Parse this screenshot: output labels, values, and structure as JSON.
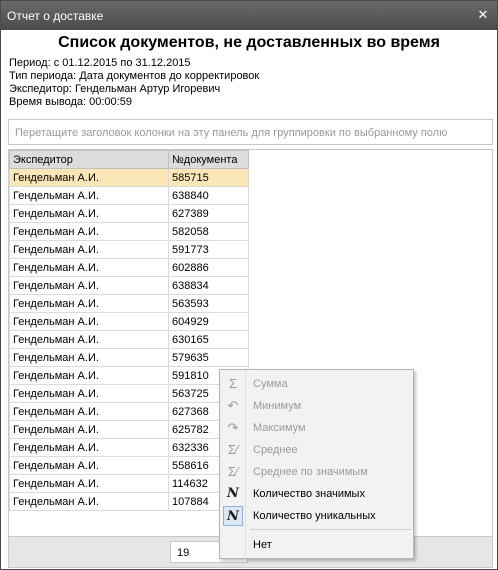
{
  "window": {
    "title": "Отчет о доставке",
    "close_glyph": "✕"
  },
  "report": {
    "title": "Список документов, не доставленных во время",
    "period": "Период: с 01.12.2015 по 31.12.2015",
    "period_type": "Тип периода: Дата документов до корректировок",
    "expeditor": "Экспедитор: Гендельман Артур Игоревич",
    "output_time": "Время вывода: 00:00:59"
  },
  "group_panel": {
    "hint": "Перетащите заголовок колонки на эту панель для группировки по выбранному полю"
  },
  "grid": {
    "columns": [
      "Экспедитор",
      "№документа"
    ],
    "rows": [
      [
        "Гендельман А.И.",
        "585715"
      ],
      [
        "Гендельман А.И.",
        "638840"
      ],
      [
        "Гендельман А.И.",
        "627389"
      ],
      [
        "Гендельман А.И.",
        "582058"
      ],
      [
        "Гендельман А.И.",
        "591773"
      ],
      [
        "Гендельман А.И.",
        "602886"
      ],
      [
        "Гендельман А.И.",
        "638834"
      ],
      [
        "Гендельман А.И.",
        "563593"
      ],
      [
        "Гендельман А.И.",
        "604929"
      ],
      [
        "Гендельман А.И.",
        "630165"
      ],
      [
        "Гендельман А.И.",
        "579635"
      ],
      [
        "Гендельман А.И.",
        "591810"
      ],
      [
        "Гендельман А.И.",
        "563725"
      ],
      [
        "Гендельман А.И.",
        "627368"
      ],
      [
        "Гендельман А.И.",
        "625782"
      ],
      [
        "Гендельман А.И.",
        "632336"
      ],
      [
        "Гендельман А.И.",
        "558616"
      ],
      [
        "Гендельман А.И.",
        "114632"
      ],
      [
        "Гендельман А.И.",
        "107884"
      ]
    ],
    "selected_row": 0,
    "summary_value": "19"
  },
  "context_menu": {
    "items": [
      {
        "label": "Сумма",
        "icon": "sum-icon",
        "glyph": "Σ",
        "enabled": false,
        "checked": false
      },
      {
        "label": "Минимум",
        "icon": "minimum-icon",
        "glyph": "↶",
        "enabled": false,
        "checked": false
      },
      {
        "label": "Максимум",
        "icon": "maximum-icon",
        "glyph": "↷",
        "enabled": false,
        "checked": false
      },
      {
        "label": "Среднее",
        "icon": "average-icon",
        "glyph": "Σ⁄",
        "enabled": false,
        "checked": false
      },
      {
        "label": "Среднее по значимым",
        "icon": "average-nonempty-icon",
        "glyph": "Σ⁄",
        "enabled": false,
        "checked": false
      },
      {
        "label": "Количество значимых",
        "icon": "count-nonempty-icon",
        "glyph": "N",
        "enabled": true,
        "checked": false
      },
      {
        "label": "Количество уникальных",
        "icon": "count-unique-icon",
        "glyph": "N",
        "enabled": true,
        "checked": true
      },
      {
        "label": "Нет",
        "icon": "",
        "glyph": "",
        "enabled": true,
        "checked": false
      }
    ]
  },
  "colors": {
    "titlebar": "#555555",
    "selected_row": "#fbe6b8",
    "disabled_text": "#9a9a9a"
  }
}
